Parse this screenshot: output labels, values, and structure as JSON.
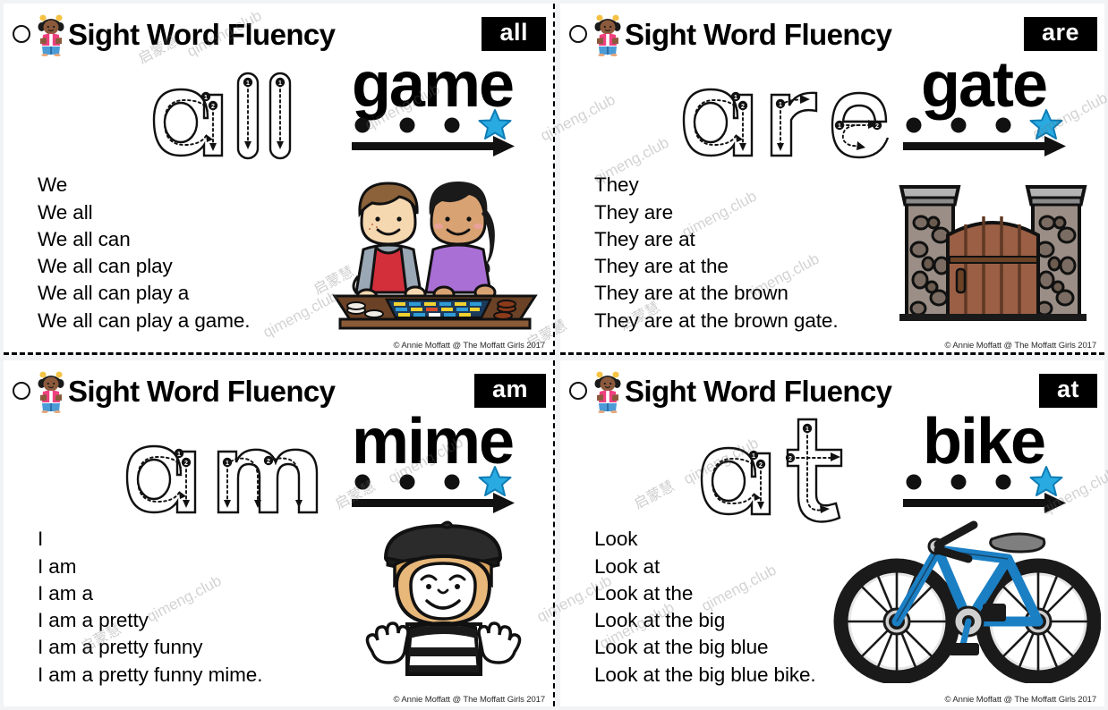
{
  "page": {
    "title": "Sight Word Fluency Cards",
    "copyright": "© Annie Moffatt @ The Moffatt Girls 2017",
    "accent_blue": "#29ABE2",
    "badge_bg": "#000000",
    "badge_fg": "#ffffff"
  },
  "watermark": {
    "latin": "qimeng.club",
    "cjk": "启蒙慧"
  },
  "cards": [
    {
      "id": "card-all",
      "header_title": "Sight Word Fluency",
      "sight_word": "all",
      "trace_word": "all",
      "picture_word": "game",
      "dots": 3,
      "star": true,
      "sentences": [
        "We",
        "We all",
        "We all can",
        "We all can play",
        "We all can play a",
        "We all can play a game."
      ],
      "illustration": "two-kids-playing-board-game",
      "copyright": "© Annie Moffatt @ The Moffatt Girls 2017"
    },
    {
      "id": "card-are",
      "header_title": "Sight Word Fluency",
      "sight_word": "are",
      "trace_word": "are",
      "picture_word": "gate",
      "dots": 3,
      "star": true,
      "sentences": [
        "They",
        "They are",
        "They are at",
        "They are at the",
        "They are at the brown",
        "They are at the brown gate."
      ],
      "illustration": "brown-wooden-gate-with-stone-pillars",
      "copyright": "© Annie Moffatt @ The Moffatt Girls 2017"
    },
    {
      "id": "card-am",
      "header_title": "Sight Word Fluency",
      "sight_word": "am",
      "trace_word": "am",
      "picture_word": "mime",
      "dots": 3,
      "star": true,
      "sentences": [
        "I",
        "I am",
        "I am a",
        "I am a pretty",
        "I am a pretty funny",
        "I am a pretty funny mime."
      ],
      "illustration": "mime-boy-with-beret",
      "copyright": "© Annie Moffatt @ The Moffatt Girls 2017"
    },
    {
      "id": "card-at",
      "header_title": "Sight Word Fluency",
      "sight_word": "at",
      "trace_word": "at",
      "picture_word": "bike",
      "dots": 3,
      "star": true,
      "sentences": [
        "Look",
        "Look at",
        "Look at the",
        "Look at the big",
        "Look at the big blue",
        "Look at the big blue bike."
      ],
      "illustration": "blue-bicycle",
      "copyright": "© Annie Moffatt @ The Moffatt Girls 2017"
    }
  ]
}
